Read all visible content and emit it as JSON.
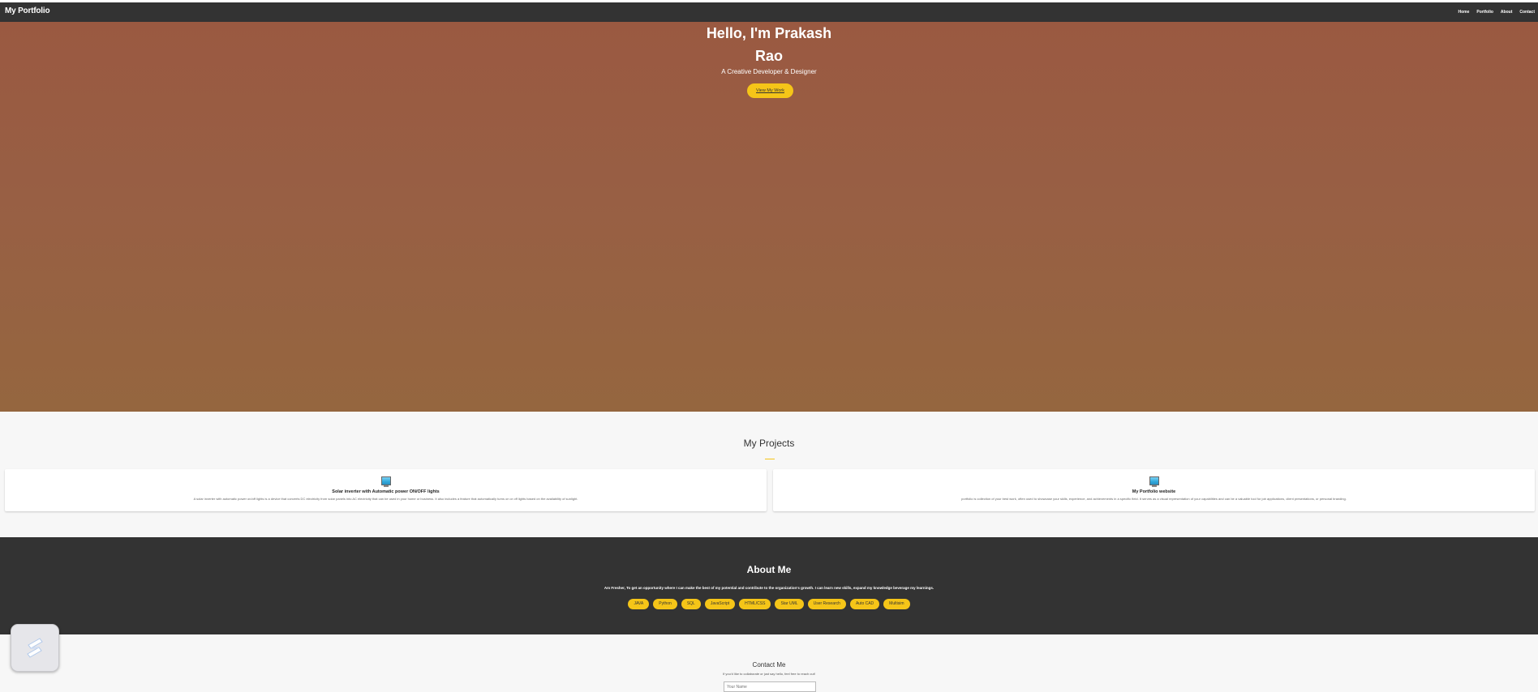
{
  "navbar": {
    "brand": "My Portfolio",
    "links": [
      "Home",
      "Portfolio",
      "About",
      "Contact"
    ]
  },
  "hero": {
    "title_line1": "Hello, I'm Prakash",
    "title_line2": "Rao",
    "subtitle": "A Creative Developer & Designer",
    "cta_label": "View My Work"
  },
  "projects": {
    "title": "My Projects",
    "items": [
      {
        "icon": "laptop-icon",
        "title": "Solar inverter with Automatic power ON/OFF lights",
        "description": "A solar inverter with automatic power on/off lights is a device that converts DC electricity from solar panels into AC electricity that can be used in your home or business. It also includes a feature that automatically turns on or off lights based on the availability of sunlight."
      },
      {
        "icon": "laptop-icon",
        "title": "My Portfolio website",
        "description": "portfolio is collection of your best work, often used to showcase your skills, experience, and achievements in a specific field. It serves as a visual representation of your capabilities and can be a valuable tool for job applications, client presentations, or personal branding."
      }
    ]
  },
  "about": {
    "title": "About Me",
    "text": "Am Fresher, To get an opportunity where I can make the best of my potential and contribute to the organization's growth. I can learn new skills, expand my knowledge beverage my learnings.",
    "skills": [
      "JAVA",
      "Python",
      "SQL",
      "JavaScript",
      "HTML/CSS",
      "Star UML",
      "User Research",
      "Auto CAD",
      "Multisim"
    ]
  },
  "contact": {
    "title": "Contact Me",
    "subtitle": "If you'd like to collaborate or just say hello, feel free to reach out!",
    "name_placeholder": "Your Name"
  },
  "colors": {
    "navbar": "#333333",
    "accent": "#f5c518",
    "hero_start": "#9a5941",
    "hero_end": "#95663f"
  }
}
